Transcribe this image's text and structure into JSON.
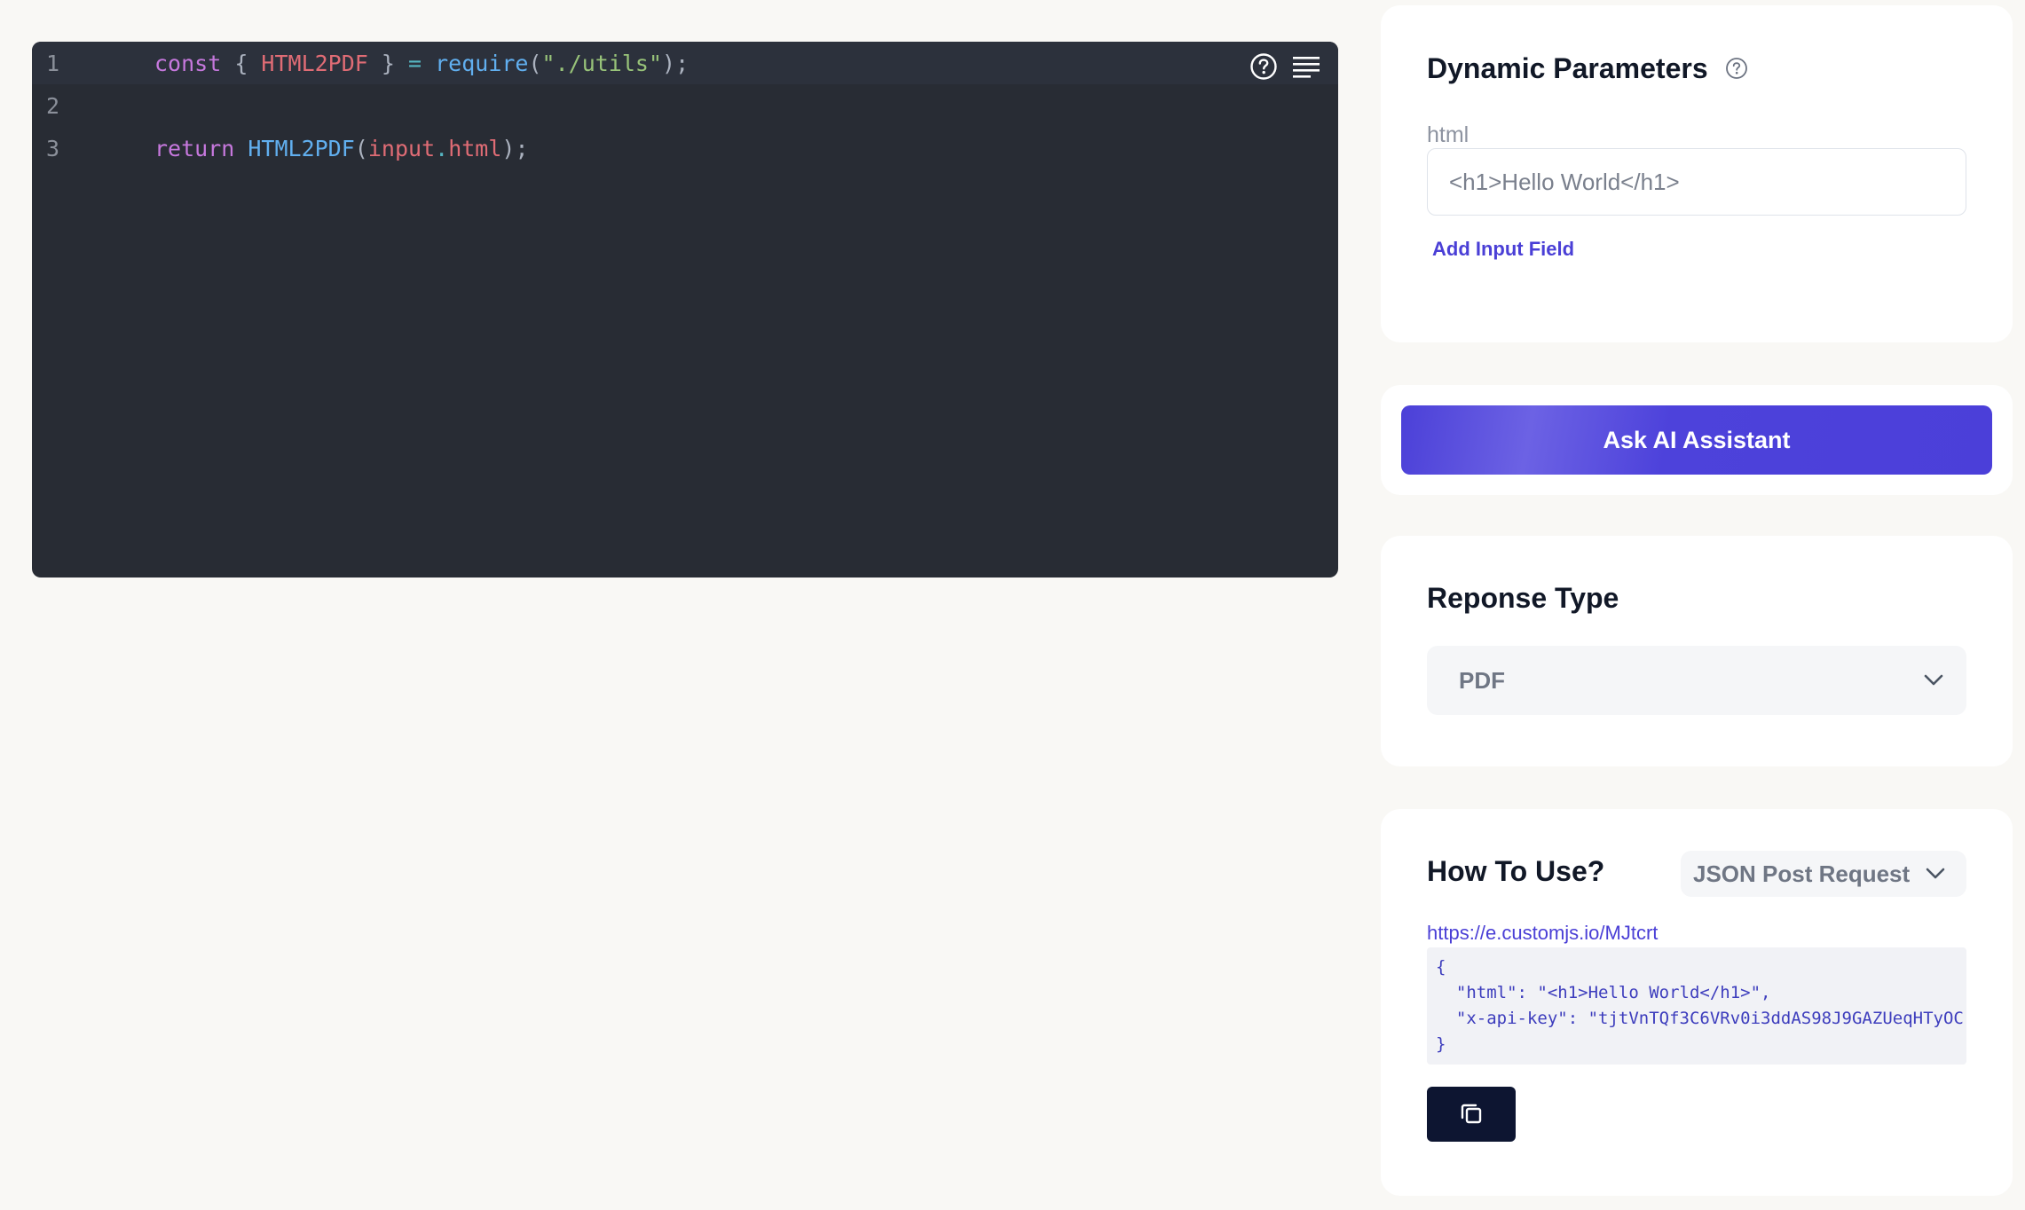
{
  "editor": {
    "lines": [
      {
        "number": "1",
        "tokens": {
          "kw": "const",
          "open": " { ",
          "name": "HTML2PDF",
          "close": " } ",
          "eq": "=",
          "space": " ",
          "fn": "require",
          "lp": "(",
          "str": "\"./utils\"",
          "rp": ");"
        }
      },
      {
        "number": "2"
      },
      {
        "number": "3",
        "tokens": {
          "kw": "return",
          "space": " ",
          "fn": "HTML2PDF",
          "lp": "(",
          "obj": "input",
          "dot": ".",
          "prop": "html",
          "rp": ");"
        }
      }
    ],
    "tools": [
      "help-icon",
      "format-icon"
    ]
  },
  "params": {
    "title": "Dynamic Parameters",
    "field_label": "html",
    "field_value": "<h1>Hello World</h1>",
    "add_field_label": "Add Input Field"
  },
  "assistant": {
    "button_label": "Ask AI Assistant"
  },
  "response": {
    "title": "Reponse Type",
    "selected": "PDF"
  },
  "howto": {
    "title": "How To Use?",
    "request_type": "JSON Post Request",
    "endpoint": "https://e.customjs.io/MJtcrt",
    "json_lines": [
      "{",
      "  \"html\": \"<h1>Hello World</h1>\",",
      "  \"x-api-key\": \"tjtVnTQf3C6VRv0i3ddAS98J9GAZUeqHTyOC",
      "}"
    ]
  },
  "colors": {
    "accent": "#4a3fd6",
    "editor_bg": "#282c34",
    "page_bg": "#f9f8f5",
    "copy_button": "#0d1531"
  }
}
